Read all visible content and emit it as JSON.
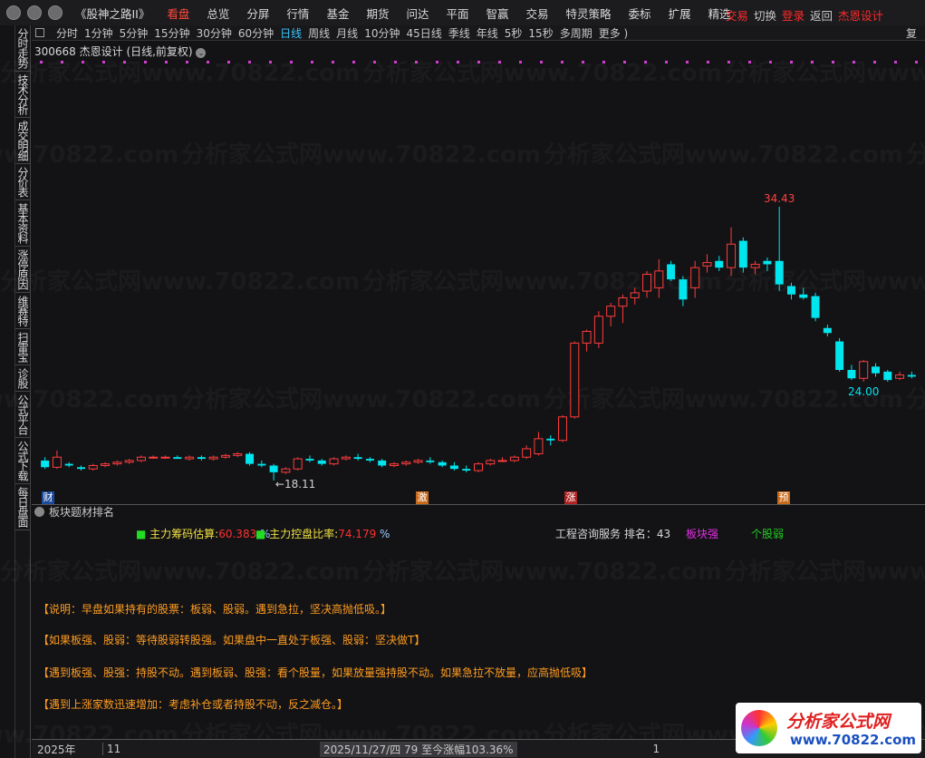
{
  "window": {
    "app_title": "《股神之路II》"
  },
  "menu": [
    "看盘",
    "总览",
    "分屏",
    "行情",
    "基金",
    "期货",
    "问达",
    "平面",
    "智赢",
    "交易",
    "特灵策略",
    "委标",
    "扩展",
    "精选"
  ],
  "menu_right": [
    "交易",
    "切换",
    "登录",
    "返回",
    "杰恩设计"
  ],
  "sidebar": [
    "分时走势",
    "技术分析",
    "成交明细",
    "分价表",
    "基本资料",
    "涨停原因",
    "维赛特",
    "扫雷宝",
    "诊股",
    "公式平台",
    "公式下载",
    "每日盘面"
  ],
  "periods": [
    "分时",
    "1分钟",
    "5分钟",
    "15分钟",
    "30分钟",
    "60分钟",
    "日线",
    "周线",
    "月线",
    "10分钟",
    "45日线",
    "季线",
    "年线",
    "5秒",
    "15秒",
    "多周期",
    "更多 )"
  ],
  "active_period": "日线",
  "right_edge_label": "复",
  "stock_info": "300668 杰恩设计 (日线,前复权)",
  "markers": [
    "财",
    "激",
    "涨",
    "预"
  ],
  "panel": {
    "title": "板块题材排名",
    "ind1_label": "主力筹码估算:",
    "ind1_value": "60.383",
    "ind2_label": "主力控盘比率:",
    "ind2_value": "74.179",
    "pct": "%",
    "service": "工程咨询服务 排名：43",
    "sector": "板块强",
    "stock": "个股弱",
    "notes": [
      "【说明：早盘如果持有的股票：板弱、股弱。遇到急拉，坚决高抛低吸。】",
      "【如果板强、股弱：等待股弱转股强。如果盘中一直处于板强、股弱：坚决做T】",
      "【遇到板强、股强：持股不动。遇到板弱、股强：看个股量，如果放量强持股不动。如果急拉不放量，应高抛低吸】",
      "【遇到上涨家数迅速增加：考虑补仓或者持股不动，反之减仓。】"
    ]
  },
  "bottom": {
    "year": "2025年",
    "month": "11",
    "status": "2025/11/27/四 79 至今涨幅103.36%",
    "page": "1"
  },
  "watermark": "分析家公式网www.70822.com",
  "logo": {
    "name": "分析家公式网",
    "url": "www.70822.com"
  },
  "colors": {
    "up": "#ff3c3c",
    "down": "#00e5ee",
    "bg": "#131316",
    "accent": "#39c4ff"
  },
  "chart_data": {
    "type": "candlestick",
    "labels": {
      "high": "34.43",
      "low_recent": "24.00",
      "low": "←18.11"
    },
    "ylim": [
      17.5,
      36
    ],
    "ohlc": [
      [
        19.3,
        19.5,
        18.8,
        18.9
      ],
      [
        18.9,
        19.9,
        18.8,
        19.5
      ],
      [
        19.1,
        19.2,
        18.9,
        19.0
      ],
      [
        18.9,
        19.0,
        18.7,
        18.8
      ],
      [
        18.8,
        19.1,
        18.7,
        19.0
      ],
      [
        19.0,
        19.2,
        18.9,
        19.1
      ],
      [
        19.1,
        19.3,
        19.0,
        19.2
      ],
      [
        19.2,
        19.4,
        19.1,
        19.3
      ],
      [
        19.3,
        19.6,
        19.2,
        19.5
      ],
      [
        19.5,
        19.6,
        19.4,
        19.5
      ],
      [
        19.5,
        19.6,
        19.4,
        19.5
      ],
      [
        19.5,
        19.6,
        19.4,
        19.4
      ],
      [
        19.4,
        19.6,
        19.3,
        19.5
      ],
      [
        19.5,
        19.6,
        19.3,
        19.4
      ],
      [
        19.4,
        19.6,
        19.3,
        19.5
      ],
      [
        19.5,
        19.7,
        19.4,
        19.6
      ],
      [
        19.6,
        19.8,
        19.5,
        19.7
      ],
      [
        19.7,
        19.8,
        19.0,
        19.1
      ],
      [
        19.1,
        19.3,
        18.9,
        19.0
      ],
      [
        19.0,
        19.1,
        18.11,
        18.6
      ],
      [
        18.6,
        18.9,
        18.5,
        18.8
      ],
      [
        18.8,
        19.5,
        18.7,
        19.4
      ],
      [
        19.4,
        19.6,
        19.2,
        19.3
      ],
      [
        19.3,
        19.4,
        19.0,
        19.1
      ],
      [
        19.1,
        19.5,
        19.0,
        19.4
      ],
      [
        19.4,
        19.6,
        19.3,
        19.5
      ],
      [
        19.5,
        19.7,
        19.3,
        19.4
      ],
      [
        19.4,
        19.5,
        19.2,
        19.3
      ],
      [
        19.3,
        19.4,
        18.9,
        19.0
      ],
      [
        19.0,
        19.2,
        18.9,
        19.1
      ],
      [
        19.1,
        19.3,
        19.0,
        19.2
      ],
      [
        19.2,
        19.4,
        19.1,
        19.3
      ],
      [
        19.3,
        19.5,
        19.1,
        19.2
      ],
      [
        19.2,
        19.3,
        18.9,
        19.0
      ],
      [
        19.0,
        19.2,
        18.7,
        18.8
      ],
      [
        18.8,
        19.0,
        18.6,
        18.7
      ],
      [
        18.7,
        19.2,
        18.6,
        19.1
      ],
      [
        19.1,
        19.4,
        19.0,
        19.3
      ],
      [
        19.3,
        19.5,
        19.2,
        19.3
      ],
      [
        19.3,
        19.6,
        19.2,
        19.5
      ],
      [
        19.5,
        20.2,
        19.4,
        20.0
      ],
      [
        19.7,
        21.0,
        19.6,
        20.6
      ],
      [
        20.6,
        20.8,
        20.2,
        20.5
      ],
      [
        20.5,
        22.0,
        20.4,
        21.9
      ],
      [
        21.9,
        26.4,
        21.8,
        26.3
      ],
      [
        26.3,
        27.1,
        25.8,
        27.0
      ],
      [
        26.3,
        28.2,
        26.0,
        27.9
      ],
      [
        27.9,
        28.7,
        27.3,
        28.5
      ],
      [
        28.5,
        29.2,
        27.5,
        29.0
      ],
      [
        29.0,
        29.6,
        28.6,
        29.3
      ],
      [
        29.4,
        30.6,
        29.0,
        30.4
      ],
      [
        29.6,
        31.3,
        29.0,
        30.6
      ],
      [
        31.0,
        31.2,
        30.0,
        30.1
      ],
      [
        30.1,
        30.3,
        28.5,
        28.9
      ],
      [
        29.6,
        31.2,
        29.0,
        30.8
      ],
      [
        30.9,
        31.6,
        30.5,
        31.1
      ],
      [
        31.2,
        31.5,
        30.6,
        30.8
      ],
      [
        30.8,
        33.2,
        30.3,
        32.2
      ],
      [
        32.4,
        32.6,
        30.5,
        30.8
      ],
      [
        30.8,
        31.2,
        30.4,
        31.0
      ],
      [
        31.2,
        31.4,
        30.6,
        31.0
      ],
      [
        31.2,
        34.43,
        29.4,
        29.8
      ],
      [
        29.7,
        29.9,
        28.9,
        29.2
      ],
      [
        29.2,
        29.6,
        28.9,
        29.0
      ],
      [
        29.1,
        29.3,
        27.6,
        27.8
      ],
      [
        27.2,
        27.4,
        26.7,
        26.9
      ],
      [
        26.4,
        26.6,
        24.6,
        24.7
      ],
      [
        24.7,
        25.0,
        24.1,
        24.2
      ],
      [
        24.2,
        25.3,
        24.0,
        25.2
      ],
      [
        24.9,
        25.1,
        24.3,
        24.5
      ],
      [
        24.6,
        24.7,
        24.0,
        24.1
      ],
      [
        24.2,
        24.6,
        24.1,
        24.4
      ],
      [
        24.4,
        24.6,
        24.2,
        24.3
      ]
    ],
    "high_index": 61,
    "low_index": 19,
    "recent_low_index": 68
  }
}
